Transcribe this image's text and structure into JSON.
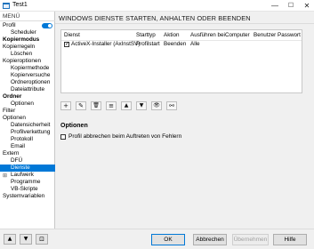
{
  "window": {
    "title": "Test1",
    "controls": {
      "minimize": "—",
      "maximize": "☐",
      "close": "✕"
    }
  },
  "sidebar": {
    "header": "MENÜ",
    "items": [
      {
        "label": "Profil",
        "level": 0,
        "bold": false
      },
      {
        "label": "Scheduler",
        "level": 1,
        "bold": false
      },
      {
        "label": "Kopiermodus",
        "level": 0,
        "bold": true
      },
      {
        "label": "Kopierregeln",
        "level": 0,
        "bold": false
      },
      {
        "label": "Löschen",
        "level": 1,
        "bold": false
      },
      {
        "label": "Kopieroptionen",
        "level": 0,
        "bold": false
      },
      {
        "label": "Kopiermethode",
        "level": 1,
        "bold": false
      },
      {
        "label": "Kopierversuche",
        "level": 1,
        "bold": false
      },
      {
        "label": "Ordneroptionen",
        "level": 1,
        "bold": false
      },
      {
        "label": "Dateiattribute",
        "level": 1,
        "bold": false
      },
      {
        "label": "Ordner",
        "level": 0,
        "bold": true
      },
      {
        "label": "Optionen",
        "level": 1,
        "bold": false
      },
      {
        "label": "Filter",
        "level": 0,
        "bold": false
      },
      {
        "label": "Optionen",
        "level": 0,
        "bold": false
      },
      {
        "label": "Datensicherheit",
        "level": 1,
        "bold": false
      },
      {
        "label": "Profilverkettung",
        "level": 1,
        "bold": false
      },
      {
        "label": "Protokoll",
        "level": 1,
        "bold": false
      },
      {
        "label": "Email",
        "level": 1,
        "bold": false
      },
      {
        "label": "Extern",
        "level": 0,
        "bold": false
      },
      {
        "label": "DFÜ",
        "level": 1,
        "bold": false
      },
      {
        "label": "Dienste",
        "level": 1,
        "bold": false,
        "selected": true
      },
      {
        "label": "Laufwerk",
        "level": 0,
        "bold": false,
        "expander": "⊞"
      },
      {
        "label": "Programme",
        "level": 1,
        "bold": false
      },
      {
        "label": "VB-Skripte",
        "level": 1,
        "bold": false
      },
      {
        "label": "Systemvariablen",
        "level": 0,
        "bold": false
      }
    ]
  },
  "main": {
    "heading": "WINDOWS DIENSTE STARTEN, ANHALTEN ODER BEENDEN",
    "table": {
      "columns": [
        "Dienst",
        "Starttyp",
        "Aktion",
        "Ausführen bei",
        "Computer",
        "Benutzer",
        "Passwort"
      ],
      "rows": [
        {
          "checked": true,
          "dienst": "ActiveX-Installer (AxInstSV)",
          "starttyp": "Profilstart",
          "aktion": "Beenden",
          "ausfuehren": "Alle",
          "computer": "",
          "benutzer": "",
          "passwort": ""
        }
      ]
    },
    "toolbar": [
      {
        "name": "add-icon",
        "glyph": "+"
      },
      {
        "name": "edit-icon",
        "glyph": "✎"
      },
      {
        "name": "delete-icon",
        "glyph": "🗑"
      },
      {
        "name": "list-icon",
        "glyph": "≡"
      },
      {
        "name": "move-up-icon",
        "glyph": "▲"
      },
      {
        "name": "move-down-icon",
        "glyph": "▼"
      },
      {
        "name": "view-icon",
        "glyph": "👁"
      },
      {
        "name": "link-icon",
        "glyph": "⚯"
      }
    ],
    "options": {
      "title": "Optionen",
      "checkbox_label": "Profil abbrechen beim Auftreten von Fehlern",
      "checkbox_checked": false
    }
  },
  "footer": {
    "nav_up": "▲",
    "nav_down": "▼",
    "screenshot_glyph": "⊡",
    "ok": "OK",
    "cancel": "Abbrechen",
    "apply": "Übernehmen",
    "help": "Hilfe"
  },
  "colors": {
    "accent": "#0078d7",
    "selected_text": "#ffffff"
  }
}
